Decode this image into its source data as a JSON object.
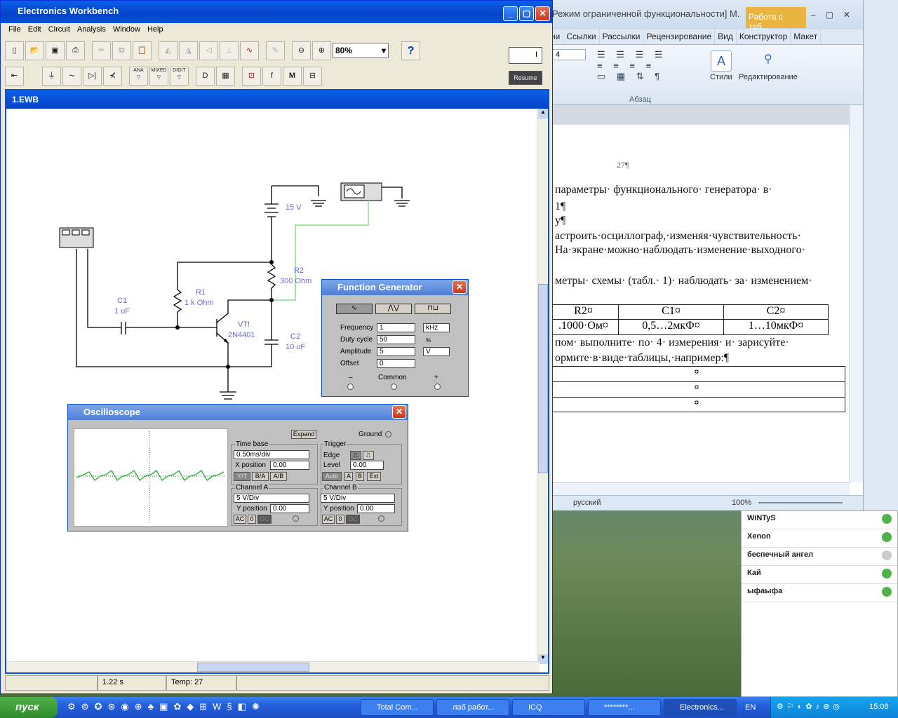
{
  "ewb": {
    "title": "Electronics Workbench",
    "menu": [
      "File",
      "Edit",
      "Circuit",
      "Analysis",
      "Window",
      "Help"
    ],
    "zoom": "80%",
    "help_glyph": "?",
    "resume": "Resume",
    "switch_glyph": "I",
    "toolbar2_labels": [
      "ANA",
      "MIXED",
      "DIGIT"
    ],
    "doc_title": "1.EWB",
    "status": {
      "time": "1.22 s",
      "temp": "Temp:  27"
    }
  },
  "circuit": {
    "v15": "15 V",
    "r2_name": "R2",
    "r2_val": "300  Ohm",
    "r1_name": "R1",
    "r1_val": "1 k Ohm",
    "c1_name": "C1",
    "c1_val": "1 uF",
    "vt_name": "VT!",
    "vt_val": "2N4401",
    "c2_name": "C2",
    "c2_val": "10 uF"
  },
  "fgen": {
    "title": "Function Generator",
    "frequency_label": "Frequency",
    "frequency": "1",
    "frequency_unit": "kHz",
    "duty_label": "Duty cycle",
    "duty": "50",
    "duty_unit": "%",
    "amplitude_label": "Amplitude",
    "amplitude": "5",
    "amplitude_unit": "V",
    "offset_label": "Offset",
    "offset": "0",
    "minus": "–",
    "common": "Common",
    "plus": "+"
  },
  "osc": {
    "title": "Oscilloscope",
    "expand": "Expand",
    "ground": "Ground",
    "timebase_label": "Time base",
    "timebase": "0.50ms/div",
    "xpos_label": "X position",
    "xpos": "0.00",
    "yt": "Y/T",
    "ba": "B/A",
    "ab": "A/B",
    "trigger_label": "Trigger",
    "edge_label": "Edge",
    "level_label": "Level",
    "level": "0.00",
    "auto": "Auto",
    "a": "A",
    "b": "B",
    "ext": "Ext",
    "chA_label": "Channel A",
    "chA": "5  V/Div",
    "chA_ypos_label": "Y position",
    "chA_ypos": "0.00",
    "chB_label": "Channel B",
    "chB": "5  V/Div",
    "chB_ypos_label": "Y position",
    "chB_ypos": "0.00",
    "ac": "AC",
    "zero": "0",
    "dc": "DC"
  },
  "word": {
    "title": "Режим ограниченной функциональности] M.",
    "context_tab": "Работа с таб...",
    "tabs": [
      "ни",
      "Ссылки",
      "Рассылки",
      "Рецензирование",
      "Вид",
      "Конструктор",
      "Макет"
    ],
    "styles": "Стили",
    "editing": "Редактирование",
    "paragraph": "Абзац",
    "font_size": "4",
    "page_num": "27¶",
    "lines": [
      "параметры·  функционального·  генератора·  в·",
      "1¶",
      "у¶",
      "астроить·осциллограф,·изменяя·чувствительность·",
      "На·экране·можно·наблюдать·изменение·выходного·",
      "метры· схемы· (табл.· 1)· наблюдать· за· изменением·",
      "пом·  выполните·  по·  4·  измерения·  и·  зарисуйте·",
      "ормите·в·виде·таблицы,·например:¶"
    ],
    "table_head": [
      "R2¤",
      "C1¤",
      "C2¤"
    ],
    "table_row": [
      ".1000·Ом¤",
      "0,5…2мкФ¤",
      "1…10мкФ¤"
    ],
    "cell_mark": "¤",
    "language": "русский",
    "zoom": "100%"
  },
  "icq_contacts": [
    "WiNTyS",
    "Xenon",
    "беспечный ангел",
    "Кай",
    "ыфаыфа"
  ],
  "taskbar": {
    "start": "пуск",
    "tasks": [
      "Total Com...",
      "лаб работ...",
      "ICQ",
      "********...",
      "Electronics..."
    ],
    "lang": "EN",
    "clock": "15:06"
  }
}
